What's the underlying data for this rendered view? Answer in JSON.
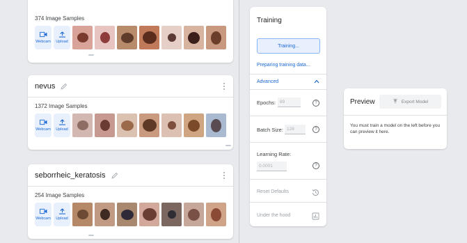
{
  "classes": [
    {
      "name": "",
      "sample_count": "374 Image Samples",
      "thumbs": [
        {
          "bg": "#d9a39a",
          "lesion": "#7a3a2e"
        },
        {
          "bg": "#e7c4bf",
          "lesion": "#8e3b3b"
        },
        {
          "bg": "#b88c6a",
          "lesion": "#5e3b2a"
        },
        {
          "bg": "#c07a5a",
          "lesion": "#5a2c1e"
        },
        {
          "bg": "#e6cfc6",
          "lesion": "#5b3a35"
        },
        {
          "bg": "#d7b3a0",
          "lesion": "#3a1f1b"
        },
        {
          "bg": "#c9997f",
          "lesion": "#6a3e2b"
        }
      ]
    },
    {
      "name": "nevus",
      "sample_count": "1372 Image Samples",
      "thumbs": [
        {
          "bg": "#d2b8b0",
          "lesion": "#8e6e64"
        },
        {
          "bg": "#c69a91",
          "lesion": "#6a3b33"
        },
        {
          "bg": "#dbc2b0",
          "lesion": "#9b6a4a"
        },
        {
          "bg": "#c99a7e",
          "lesion": "#5e3a26"
        },
        {
          "bg": "#dcc0b2",
          "lesion": "#7d4f3c"
        },
        {
          "bg": "#cfa582",
          "lesion": "#7a4a2a"
        },
        {
          "bg": "#a9b9cf",
          "lesion": "#5a4a52"
        }
      ]
    },
    {
      "name": "seborrheic_keratosis",
      "sample_count": "254 Image Samples",
      "thumbs": [
        {
          "bg": "#b58967",
          "lesion": "#6c4a33"
        },
        {
          "bg": "#c19a83",
          "lesion": "#3e2a22"
        },
        {
          "bg": "#a8886f",
          "lesion": "#2e2a38"
        },
        {
          "bg": "#d2a89a",
          "lesion": "#6b3e33"
        },
        {
          "bg": "#7c6660",
          "lesion": "#2f2e35"
        },
        {
          "bg": "#c7a79a",
          "lesion": "#7a5245"
        },
        {
          "bg": "#d0a489",
          "lesion": "#8a4a34"
        }
      ]
    }
  ],
  "source_buttons": {
    "webcam": "Webcam",
    "upload": "Upload"
  },
  "training": {
    "title": "Training",
    "button_label": "Training...",
    "status": "Preparing training data...",
    "advanced_label": "Advanced",
    "epochs_label": "Epochs:",
    "epochs_value": "89",
    "batch_size_label": "Batch Size:",
    "batch_size_value": "128",
    "learning_rate_label": "Learning Rate:",
    "learning_rate_value": "0.0001",
    "reset_label": "Reset Defaults",
    "under_hood_label": "Under the hood"
  },
  "preview": {
    "title": "Preview",
    "export_label": "Export Model",
    "message": "You must train a model on the left before you can preview it here."
  },
  "colors": {
    "accent": "#1967d2",
    "accent_light": "#e8f0fe",
    "background": "#e8eaed"
  }
}
